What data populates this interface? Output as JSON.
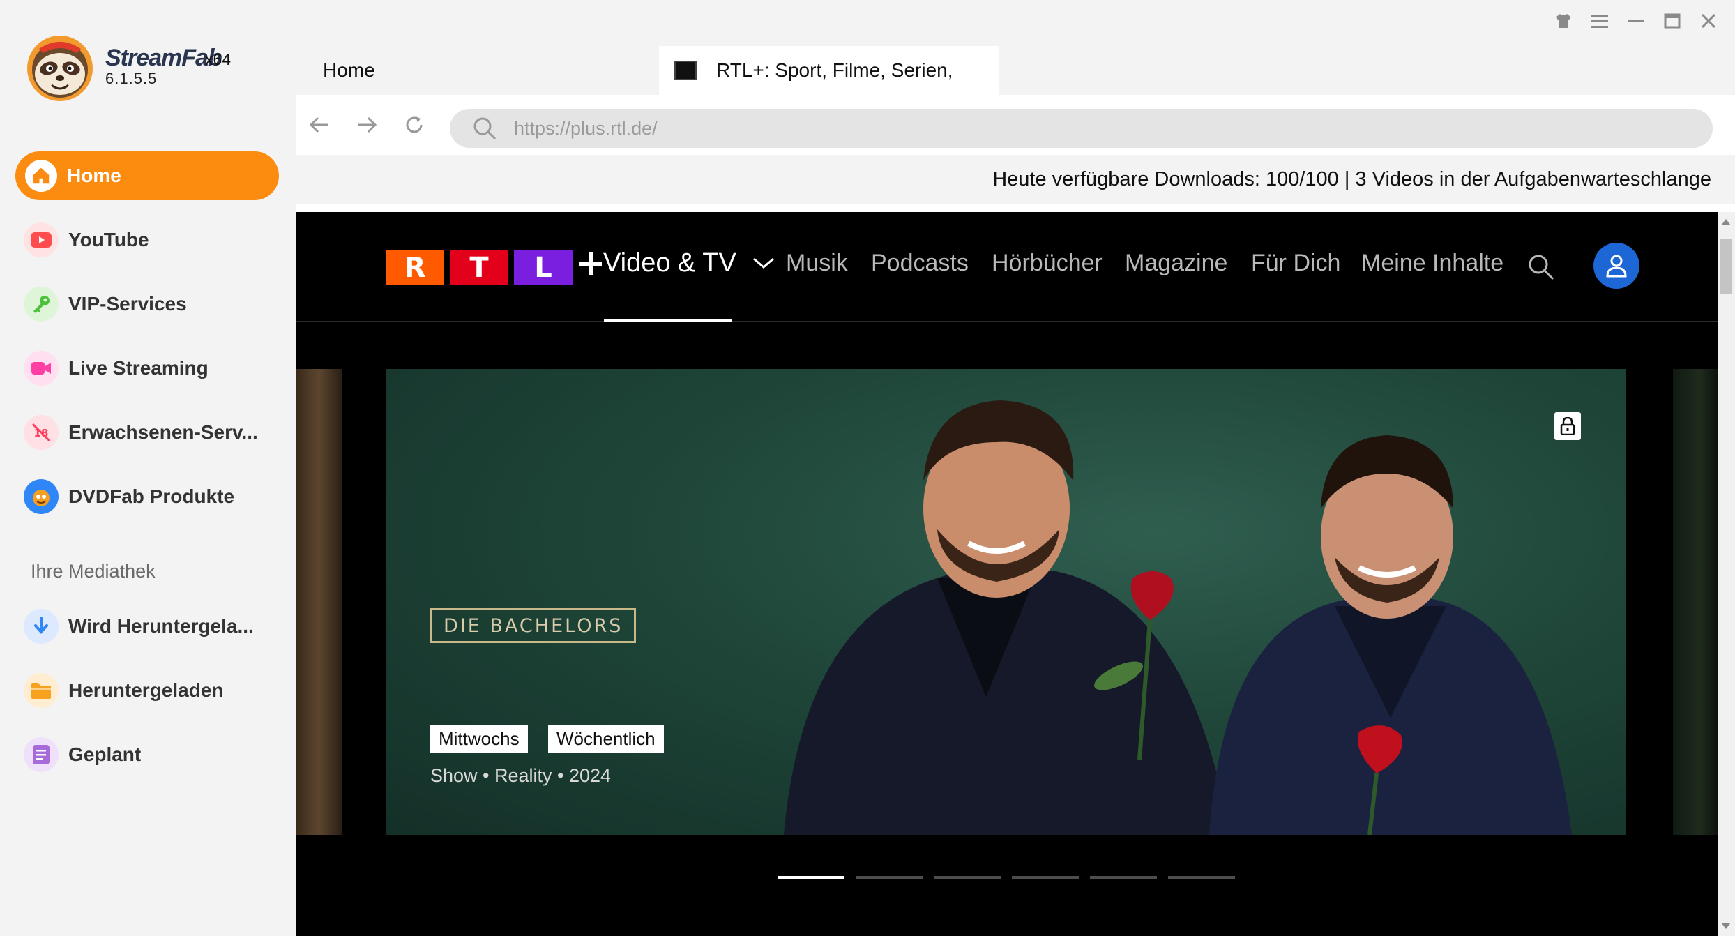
{
  "app": {
    "name": "StreamFab",
    "arch": "x64",
    "version": "6.1.5.5"
  },
  "sidebar": {
    "items": [
      {
        "label": "Home",
        "icon": "home-icon",
        "color": "#fb8c10",
        "active": true
      },
      {
        "label": "YouTube",
        "icon": "youtube-icon",
        "color": "#ff4d4d"
      },
      {
        "label": "VIP-Services",
        "icon": "key-icon",
        "color": "#4cc23a"
      },
      {
        "label": "Live Streaming",
        "icon": "video-camera-icon",
        "color": "#ff3fa4"
      },
      {
        "label": "Erwachsenen-Serv...",
        "icon": "adult-blocked-icon",
        "color": "#ff4060"
      },
      {
        "label": "DVDFab Produkte",
        "icon": "dvdfab-icon",
        "color": "#f5a020"
      }
    ],
    "library_title": "Ihre Mediathek",
    "library_items": [
      {
        "label": "Wird Heruntergela...",
        "icon": "download-arrow-icon",
        "color": "#2f86f6"
      },
      {
        "label": "Heruntergeladen",
        "icon": "folder-icon",
        "color": "#f6a21e"
      },
      {
        "label": "Geplant",
        "icon": "schedule-list-icon",
        "color": "#a66bd8"
      }
    ]
  },
  "tabs": {
    "home": "Home",
    "site": "RTL+: Sport, Filme, Serien,"
  },
  "address": {
    "url": "https://plus.rtl.de/"
  },
  "status": {
    "text": "Heute verfügbare Downloads: 100/100 | 3 Videos in der Aufgabenwarteschlange"
  },
  "rtl": {
    "logo_letters": [
      "R",
      "T",
      "L"
    ],
    "logo_colors": [
      "#ff5a00",
      "#e3001b",
      "#7a1fe0"
    ],
    "section_label": "Video & TV",
    "menu": [
      "Musik",
      "Podcasts",
      "Hörbücher",
      "Magazine",
      "Für Dich",
      "Meine Inhalte"
    ]
  },
  "hero": {
    "show_title": "DIE BACHELORS",
    "chips": [
      "Mittwochs",
      "Wöchentlich"
    ],
    "meta": "Show • Reality • 2024",
    "slide_count": 6,
    "active_slide": 1
  }
}
